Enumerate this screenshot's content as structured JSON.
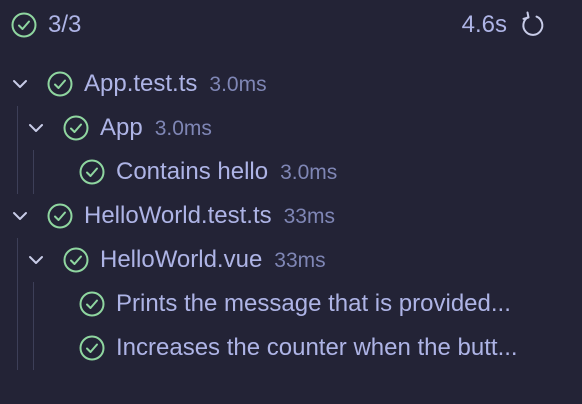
{
  "summary": {
    "icon": "check-circle-icon",
    "count": "3/3",
    "duration": "4.6s",
    "rerun_icon": "rerun-icon"
  },
  "colors": {
    "background": "#232336",
    "text": "#aeb4e6",
    "muted": "#7f86b5",
    "pass": "#8fd6a0",
    "guide": "#3d3f58"
  },
  "tree": {
    "app_test_file": {
      "label": "App.test.ts",
      "time": "3.0ms"
    },
    "app_suite": {
      "label": "App",
      "time": "3.0ms"
    },
    "app_test_contains_hello": {
      "label": "Contains hello",
      "time": "3.0ms"
    },
    "helloworld_test_file": {
      "label": "HelloWorld.test.ts",
      "time": "33ms"
    },
    "helloworld_suite": {
      "label": "HelloWorld.vue",
      "time": "33ms"
    },
    "helloworld_test_prints": {
      "label": "Prints the message that is provided..."
    },
    "helloworld_test_counter": {
      "label": "Increases the counter when the butt..."
    }
  }
}
